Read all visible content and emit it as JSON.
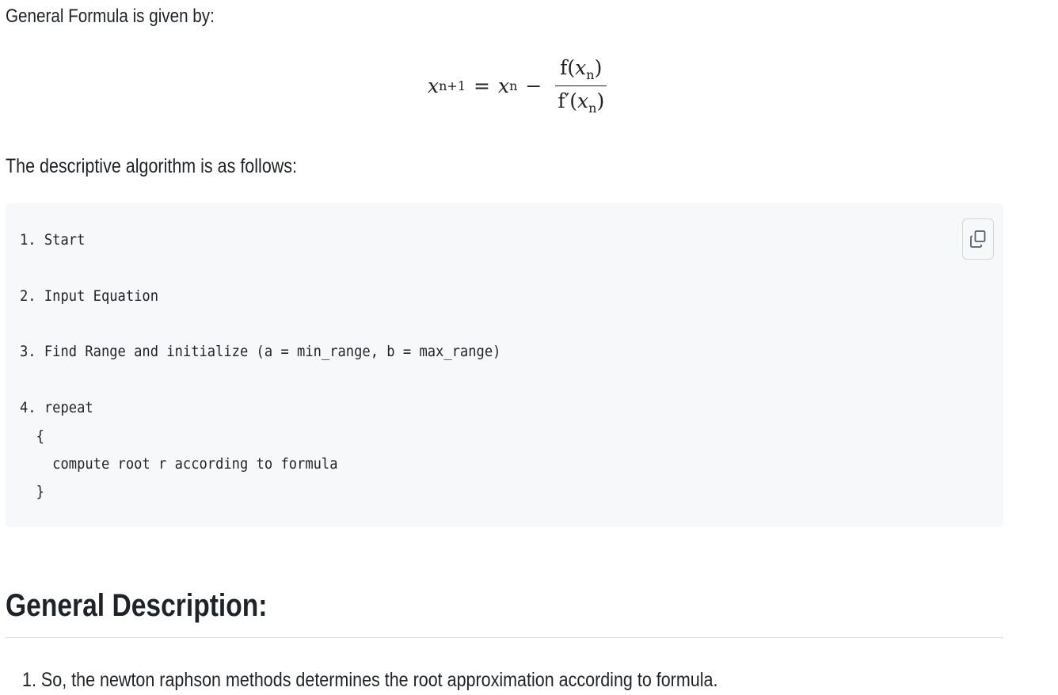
{
  "intro_text": "General Formula is given by:",
  "formula": {
    "lhs_var": "x",
    "lhs_sub": "n+1",
    "equals": "=",
    "rhs_var": "x",
    "rhs_sub": "n",
    "minus": "−",
    "numerator_fn": "f(",
    "numerator_var": "x",
    "numerator_sub": "n",
    "numerator_close": ")",
    "denominator_fn": "f′(",
    "denominator_var": "x",
    "denominator_sub": "n",
    "denominator_close": ")"
  },
  "algorithm_heading": "The descriptive algorithm is as follows:",
  "code_lines": [
    "1. Start",
    "2. Input Equation",
    "3. Find Range and initialize (a = min_range, b = max_range)",
    "4. repeat",
    "  {",
    "    compute root r according to formula",
    "  }"
  ],
  "copy_icon": "copy-icon",
  "section_heading": "General Description:",
  "description_items": [
    "1. So, the newton raphson methods determines the root approximation according to formula."
  ]
}
